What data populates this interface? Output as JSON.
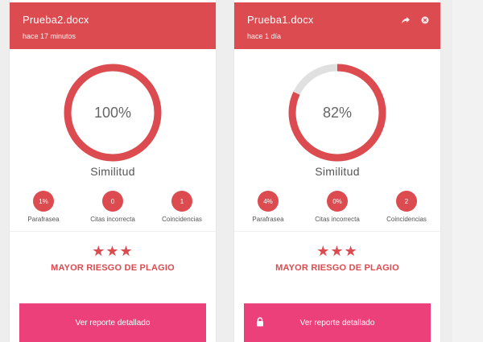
{
  "cards": [
    {
      "file_name": "Prueba2.docx",
      "time": "hace 17 minutos",
      "similarity_percent": 100,
      "similarity_label": "100%",
      "similitud_label": "Similitud",
      "stats": [
        {
          "value": "1%",
          "label": "Parafrasea"
        },
        {
          "value": "0",
          "label": "Citas incorrecta"
        },
        {
          "value": "1",
          "label": "Coincidencias"
        }
      ],
      "stars": "★★★",
      "risk_label": "MAYOR RIESGO DE PLAGIO",
      "button_label": "Ver reporte detallado",
      "header_icons": []
    },
    {
      "file_name": "Prueba1.docx",
      "time": "hace 1 día",
      "similarity_percent": 82,
      "similarity_label": "82%",
      "similitud_label": "Similitud",
      "stats": [
        {
          "value": "4%",
          "label": "Parafrasea"
        },
        {
          "value": "0%",
          "label": "Citas incorrecta"
        },
        {
          "value": "2",
          "label": "Coincidencias"
        }
      ],
      "stars": "★★★",
      "risk_label": "MAYOR RIESGO DE PLAGIO",
      "button_label": "Ver reporte detallado",
      "header_icons": [
        "share-icon",
        "close-icon"
      ],
      "button_icon": "lock-icon"
    }
  ],
  "colors": {
    "header": "#db4b4f",
    "accent": "#db4b4f",
    "button": "#ec407a",
    "ring_track": "#e0e0e0"
  }
}
